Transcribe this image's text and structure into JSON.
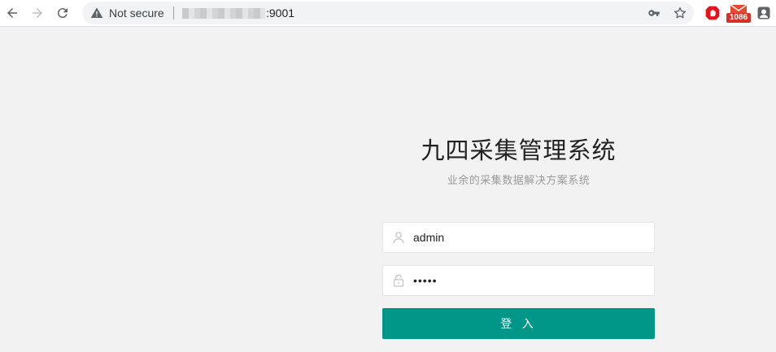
{
  "browser": {
    "security_label": "Not secure",
    "url_port": ":9001",
    "extension_badge": "1086"
  },
  "login": {
    "title": "九四采集管理系统",
    "subtitle": "业余的采集数据解决方案系统",
    "username_value": "admin",
    "password_value": "•••••",
    "submit_label": "登 入"
  },
  "colors": {
    "primary": "#009688",
    "page_background": "#f2f2f2"
  }
}
